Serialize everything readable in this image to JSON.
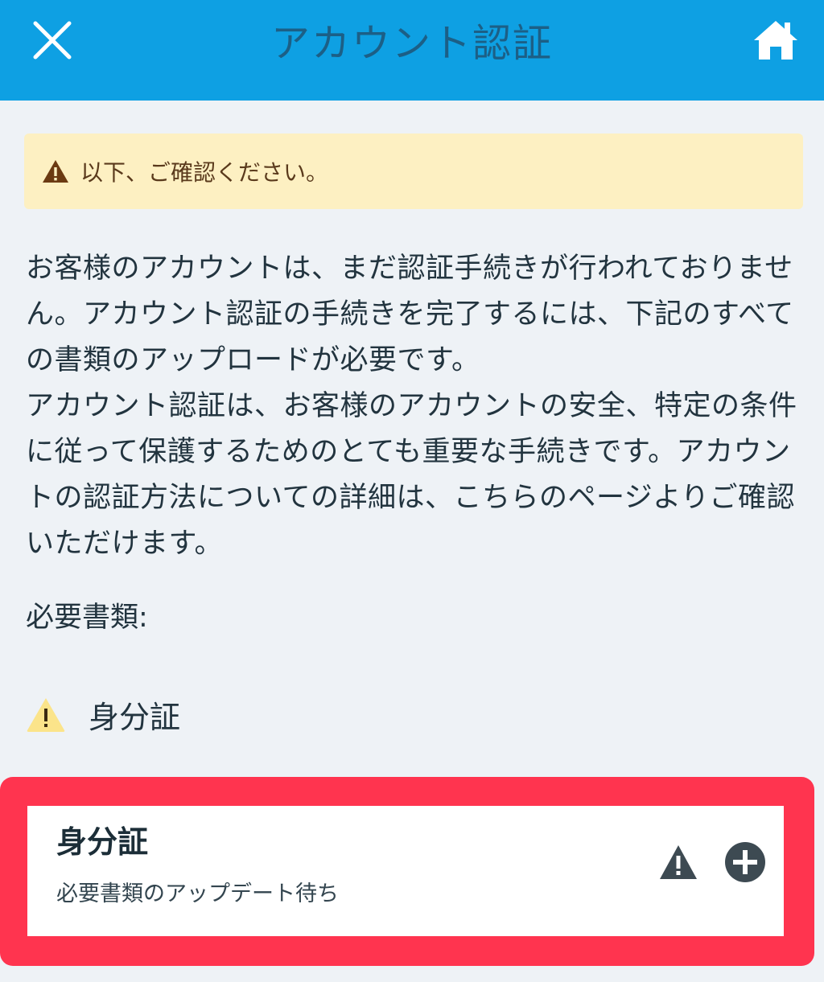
{
  "header": {
    "title": "アカウント認証",
    "close_icon": "close-icon",
    "home_icon": "home-icon",
    "background": "#0ea0e3"
  },
  "alert": {
    "icon": "warning-icon",
    "text": "以下、ご確認ください。",
    "background": "#fdf0c2"
  },
  "description": {
    "paragraph1": "お客様のアカウントは、まだ認証手続きが行われておりません。アカウント認証の手続きを完了するには、下記のすべての書類のアップロードが必要です。",
    "paragraph2": "アカウント認証は、お客様のアカウントの安全、特定の条件に従って保護するためのとても重要な手続きです。アカウントの認証方法についての詳細は、こちらのページよりご確認いただけます。"
  },
  "required": {
    "label": "必要書類:",
    "items": [
      {
        "icon": "warning-yellow-icon",
        "label": "身分証"
      }
    ]
  },
  "document_card": {
    "title": "身分証",
    "status": "必要書類のアップデート待ち",
    "warn_icon": "warning-icon",
    "add_icon": "plus-circle-icon",
    "highlight_color": "#ff344f"
  }
}
